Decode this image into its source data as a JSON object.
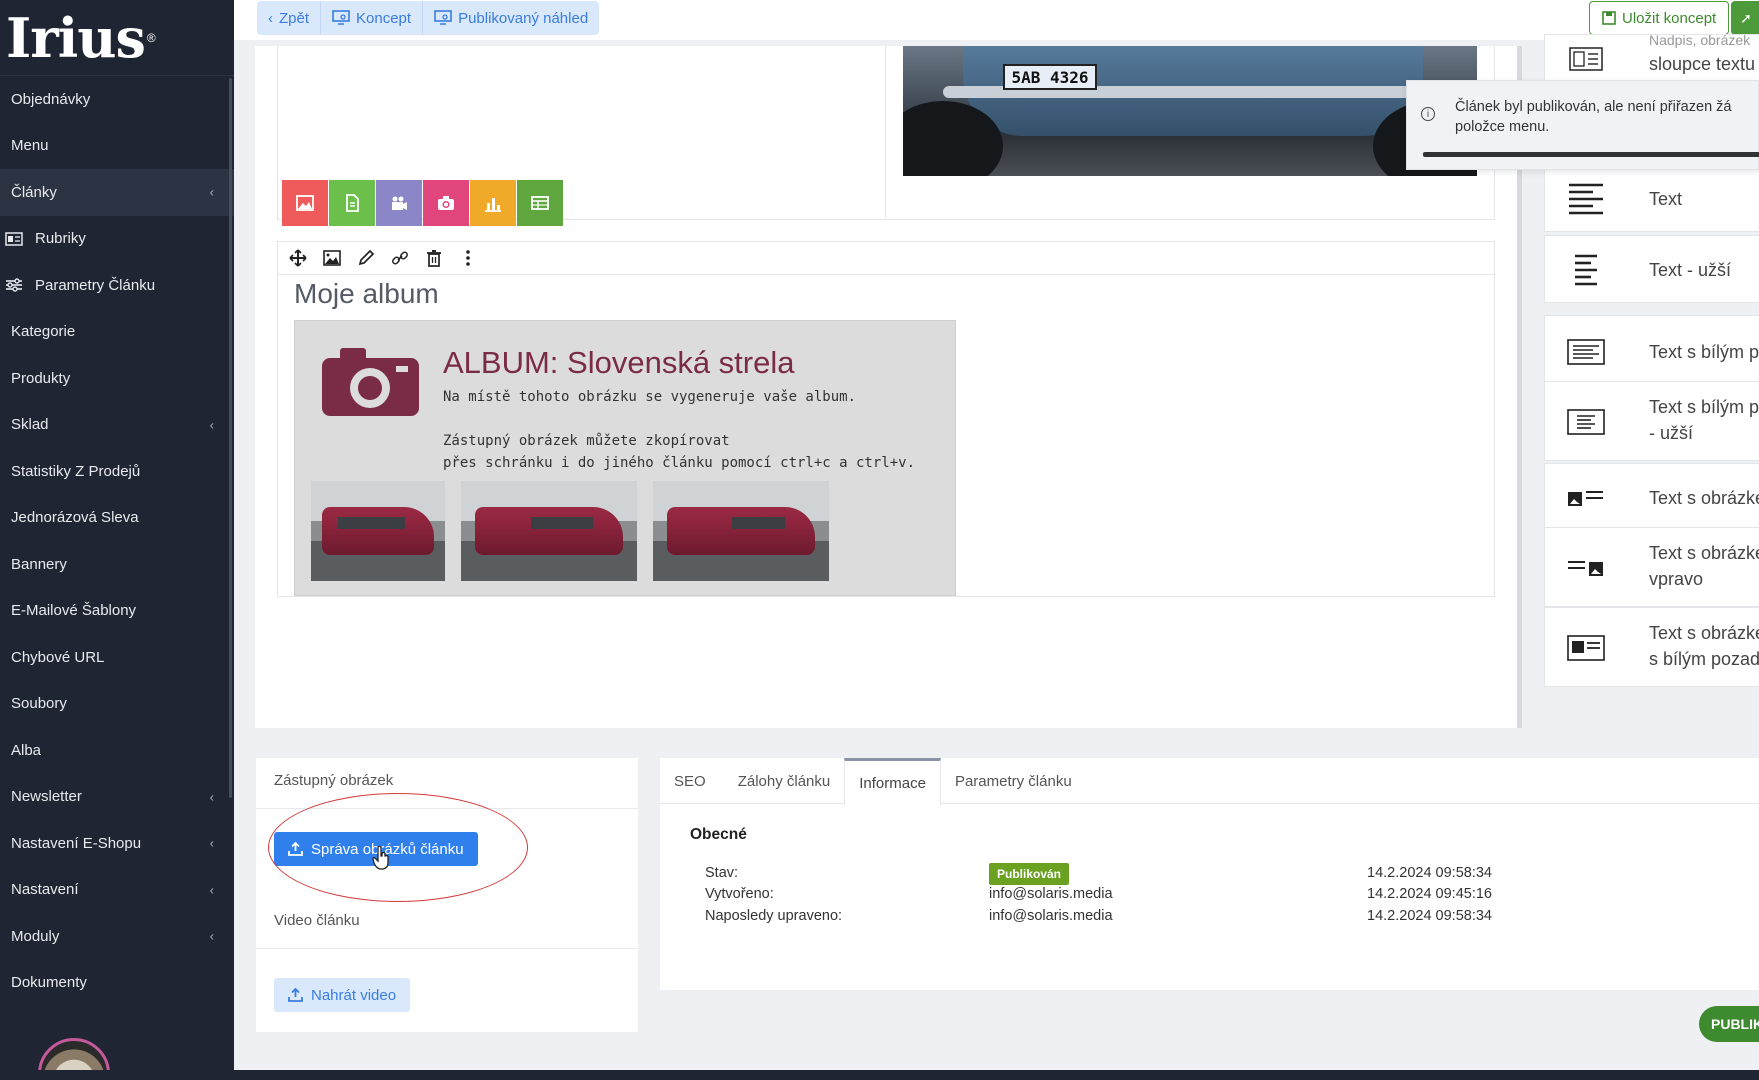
{
  "sidebar": {
    "logo": "Irius",
    "logo_mark": "®",
    "items": [
      {
        "label": "Objednávky",
        "chevron": false,
        "active": false,
        "sub": false
      },
      {
        "label": "Menu",
        "chevron": false,
        "active": false,
        "sub": false
      },
      {
        "label": "Články",
        "chevron": true,
        "active": true,
        "sub": false
      },
      {
        "label": "Rubriky",
        "chevron": false,
        "active": false,
        "sub": true,
        "icon": "news-icon"
      },
      {
        "label": "Parametry Článku",
        "chevron": false,
        "active": false,
        "sub": true,
        "icon": "sliders-icon"
      },
      {
        "label": "Kategorie",
        "chevron": false,
        "active": false,
        "sub": false
      },
      {
        "label": "Produkty",
        "chevron": false,
        "active": false,
        "sub": false
      },
      {
        "label": "Sklad",
        "chevron": true,
        "active": false,
        "sub": false
      },
      {
        "label": "Statistiky Z Prodejů",
        "chevron": false,
        "active": false,
        "sub": false
      },
      {
        "label": "Jednorázová Sleva",
        "chevron": false,
        "active": false,
        "sub": false
      },
      {
        "label": "Bannery",
        "chevron": false,
        "active": false,
        "sub": false
      },
      {
        "label": "E-Mailové Šablony",
        "chevron": false,
        "active": false,
        "sub": false
      },
      {
        "label": "Chybové URL",
        "chevron": false,
        "active": false,
        "sub": false
      },
      {
        "label": "Soubory",
        "chevron": false,
        "active": false,
        "sub": false
      },
      {
        "label": "Alba",
        "chevron": false,
        "active": false,
        "sub": false
      },
      {
        "label": "Newsletter",
        "chevron": true,
        "active": false,
        "sub": false
      },
      {
        "label": "Nastavení E-Shopu",
        "chevron": true,
        "active": false,
        "sub": false
      },
      {
        "label": "Nastavení",
        "chevron": true,
        "active": false,
        "sub": false
      },
      {
        "label": "Moduly",
        "chevron": true,
        "active": false,
        "sub": false
      },
      {
        "label": "Dokumenty",
        "chevron": false,
        "active": false,
        "sub": false
      }
    ]
  },
  "topbar": {
    "back_label": "Zpět",
    "draft_label": "Koncept",
    "preview_label": "Publikovaný náhled",
    "save_draft_label": "Uložit koncept"
  },
  "editor": {
    "plate": "5AB 4326",
    "tile_colors": [
      "#ef5b5b",
      "#6cbf4a",
      "#8a86c8",
      "#e0457b",
      "#f0a928",
      "#5fa63e"
    ],
    "block_title": "Moje album",
    "album": {
      "title": "ALBUM: Slovenská strela",
      "line1": "Na místě tohoto obrázku se vygeneruje vaše album.",
      "line2": "Zástupný obrázek můžete zkopírovat",
      "line3": "přes schránku i do jiného článku pomocí ctrl+c a ctrl+v."
    }
  },
  "palette": {
    "top_partial": "sloupce textu",
    "top_partial_cut": "Nadpis, obrázek",
    "items": [
      {
        "line1": "Text",
        "line2": "",
        "icon": "align-left-icon"
      },
      {
        "line1": "Text - užší",
        "line2": "",
        "icon": "align-narrow-icon"
      },
      {
        "line1": "Text s bílým poz",
        "line2": "",
        "icon": "boxed-text-icon"
      },
      {
        "line1": "Text s bílým poz",
        "line2": "- užší",
        "icon": "boxed-narrow-text-icon"
      },
      {
        "line1": "Text s obrázkem",
        "line2": "",
        "icon": "image-text-icon"
      },
      {
        "line1": "Text s obrázkem",
        "line2": "vpravo",
        "icon": "text-image-right-icon"
      },
      {
        "line1": "Text s obrázkem",
        "line2": "s bílým pozadím",
        "icon": "image-text-boxed-icon"
      }
    ]
  },
  "toast": {
    "text": "Článek byl publikován, ale není přiřazen žá položce menu."
  },
  "left_card": {
    "placeholder_label": "Zástupný obrázek",
    "manage_images_button": "Správa obrázků článku",
    "video_label": "Video článku",
    "upload_video_button": "Nahrát video"
  },
  "right_card": {
    "tabs": [
      "SEO",
      "Zálohy článku",
      "Informace",
      "Parametry článku"
    ],
    "active_tab": 2,
    "section_title": "Obecné",
    "rows": [
      {
        "label": "Stav:",
        "value": "Publikován",
        "date": "14.2.2024 09:58:34"
      },
      {
        "label": "Vytvořeno:",
        "value": "info@solaris.media",
        "date": "14.2.2024 09:45:16"
      },
      {
        "label": "Naposledy upraveno:",
        "value": "info@solaris.media",
        "date": "14.2.2024 09:58:34"
      }
    ]
  },
  "publish_button": "PUBLIK"
}
